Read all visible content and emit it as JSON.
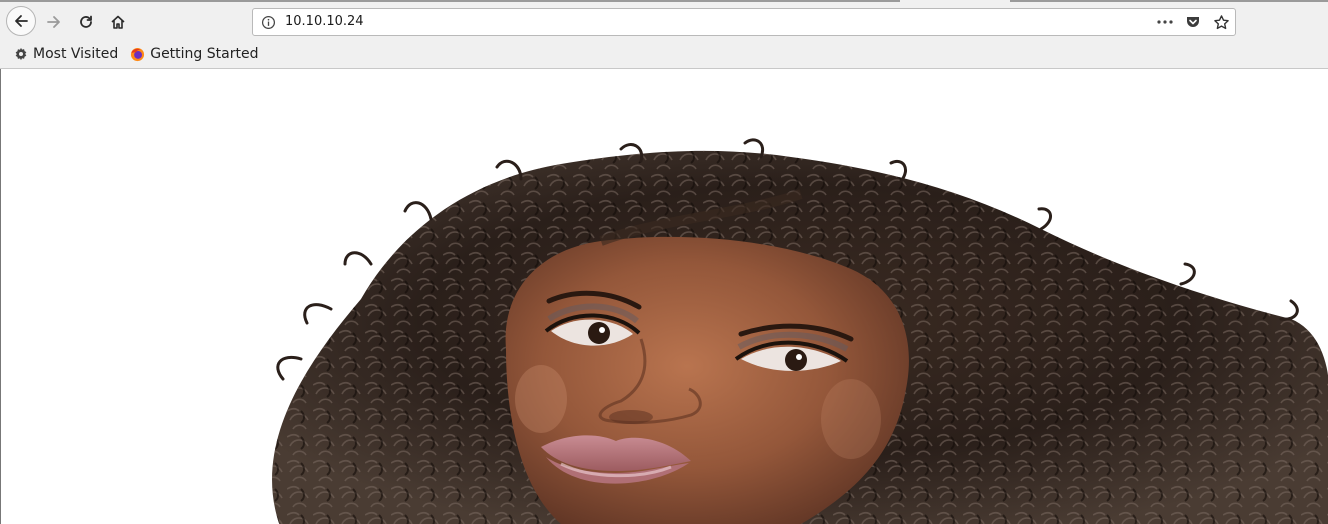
{
  "toolbar": {
    "back_icon": "arrow-left-icon",
    "forward_icon": "arrow-right-icon",
    "reload_icon": "reload-icon",
    "home_icon": "home-icon"
  },
  "urlbar": {
    "url": "10.10.10.24",
    "info_icon": "info-icon",
    "actions": [
      "more-icon",
      "pocket-icon",
      "star-icon"
    ]
  },
  "bookmarks": {
    "items": [
      {
        "label": "Most Visited",
        "icon": "gear-icon"
      },
      {
        "label": "Getting Started",
        "icon": "firefox-icon"
      }
    ]
  },
  "page": {
    "hero_image": "portrait-photo",
    "background": "#ffffff"
  }
}
